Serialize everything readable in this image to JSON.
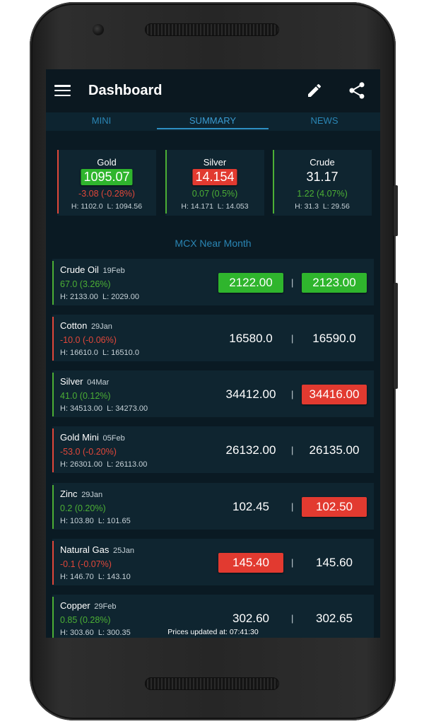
{
  "app": {
    "title": "Dashboard"
  },
  "header_icons": [
    "menu-icon",
    "edit-icon",
    "share-icon"
  ],
  "tabs": [
    {
      "label": "MINI",
      "active": false
    },
    {
      "label": "SUMMARY",
      "active": true
    },
    {
      "label": "NEWS",
      "active": false
    }
  ],
  "summary": [
    {
      "name": "Gold",
      "price": "1095.07",
      "change": "-3.08 (-0.28%)",
      "high": "H: 1102.0",
      "low": "L: 1094.56",
      "trend": "down",
      "highlight": "green"
    },
    {
      "name": "Silver",
      "price": "14.154",
      "change": "0.07 (0.5%)",
      "high": "H: 14.171",
      "low": "L: 14.053",
      "trend": "up",
      "highlight": "red"
    },
    {
      "name": "Crude",
      "price": "31.17",
      "change": "1.22 (4.07%)",
      "high": "H: 31.3",
      "low": "L: 29.56",
      "trend": "up",
      "highlight": "none"
    }
  ],
  "section_title": "MCX Near Month",
  "commodities": [
    {
      "name": "Crude Oil",
      "expiry": "19Feb",
      "change": "67.0 (3.26%)",
      "high": "H: 2133.00",
      "low": "L: 2029.00",
      "trend": "up",
      "bid": "2122.00",
      "bid_highlight": "green",
      "ask": "2123.00",
      "ask_highlight": "green"
    },
    {
      "name": "Cotton",
      "expiry": "29Jan",
      "change": "-10.0 (-0.06%)",
      "high": "H: 16610.0",
      "low": "L: 16510.0",
      "trend": "down",
      "bid": "16580.0",
      "bid_highlight": "none",
      "ask": "16590.0",
      "ask_highlight": "none"
    },
    {
      "name": "Silver",
      "expiry": "04Mar",
      "change": "41.0 (0.12%)",
      "high": "H: 34513.00",
      "low": "L: 34273.00",
      "trend": "up",
      "bid": "34412.00",
      "bid_highlight": "none",
      "ask": "34416.00",
      "ask_highlight": "red"
    },
    {
      "name": "Gold Mini",
      "expiry": "05Feb",
      "change": "-53.0 (-0.20%)",
      "high": "H: 26301.00",
      "low": "L: 26113.00",
      "trend": "down",
      "bid": "26132.00",
      "bid_highlight": "none",
      "ask": "26135.00",
      "ask_highlight": "none"
    },
    {
      "name": "Zinc",
      "expiry": "29Jan",
      "change": "0.2 (0.20%)",
      "high": "H: 103.80",
      "low": "L: 101.65",
      "trend": "up",
      "bid": "102.45",
      "bid_highlight": "none",
      "ask": "102.50",
      "ask_highlight": "red"
    },
    {
      "name": "Natural Gas",
      "expiry": "25Jan",
      "change": "-0.1 (-0.07%)",
      "high": "H: 146.70",
      "low": "L: 143.10",
      "trend": "down",
      "bid": "145.40",
      "bid_highlight": "red",
      "ask": "145.60",
      "ask_highlight": "none"
    },
    {
      "name": "Copper",
      "expiry": "29Feb",
      "change": "0.85 (0.28%)",
      "high": "H: 303.60",
      "low": "L: 300.35",
      "trend": "up",
      "bid": "302.60",
      "bid_highlight": "none",
      "ask": "302.65",
      "ask_highlight": "none"
    }
  ],
  "separator": "|",
  "footer": {
    "updated": "Prices updated at: 07:41:30"
  },
  "colors": {
    "up": "#4caf35",
    "down": "#e0473a",
    "green_box": "#2fb52d",
    "red_box": "#e23a30",
    "accent": "#2a86b5",
    "background": "#0a1a23"
  }
}
